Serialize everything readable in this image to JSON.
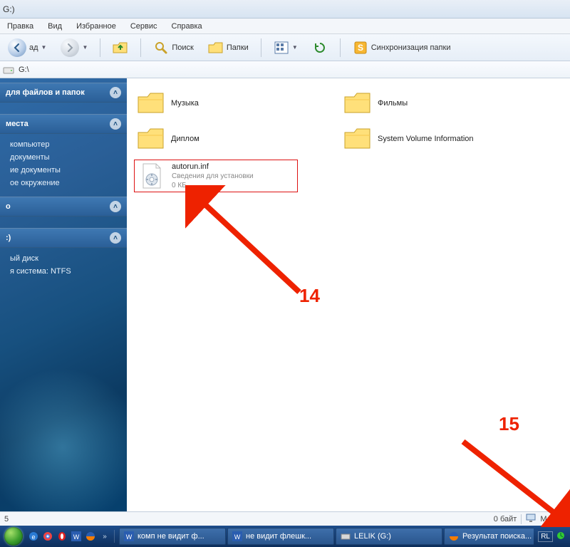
{
  "window": {
    "title_fragment": "G:)"
  },
  "menu": {
    "edit": "Правка",
    "view": "Вид",
    "favorites": "Избранное",
    "tools": "Сервис",
    "help": "Справка"
  },
  "toolbar": {
    "back_suffix": "ад",
    "search_label": "Поиск",
    "folders_label": "Папки",
    "sync_label": "Синхронизация папки"
  },
  "address": {
    "path": "G:\\"
  },
  "sidebar": {
    "section_tasks": "для файлов и папок",
    "section_places": {
      "title": "места",
      "items": [
        "компьютер",
        "документы",
        "ие документы",
        "ое окружение"
      ]
    },
    "section_o": {
      "title": "о"
    },
    "section_disk": {
      "title": ":)",
      "items": [
        "ый диск",
        "я система: NTFS"
      ]
    }
  },
  "files": [
    {
      "name": "Музыка",
      "type": "folder"
    },
    {
      "name": "Фильмы",
      "type": "folder"
    },
    {
      "name": "Диплом",
      "type": "folder"
    },
    {
      "name": "System Volume Information",
      "type": "folder"
    },
    {
      "name": "autorun.inf",
      "type": "file",
      "desc": "Сведения для установки",
      "size": "0 КБ",
      "highlight": true
    }
  ],
  "status": {
    "left": "5",
    "size": "0 байт",
    "location": "Мой ко"
  },
  "taskbar": {
    "items": [
      {
        "label": "комп не видит ф...",
        "app": "word"
      },
      {
        "label": "не видит флешк...",
        "app": "word"
      },
      {
        "label": "LELIK (G:)",
        "app": "explorer"
      },
      {
        "label": "Результат поиска...",
        "app": "firefox"
      }
    ],
    "lang": "RL"
  },
  "annotations": {
    "a14": "14",
    "a15": "15"
  }
}
